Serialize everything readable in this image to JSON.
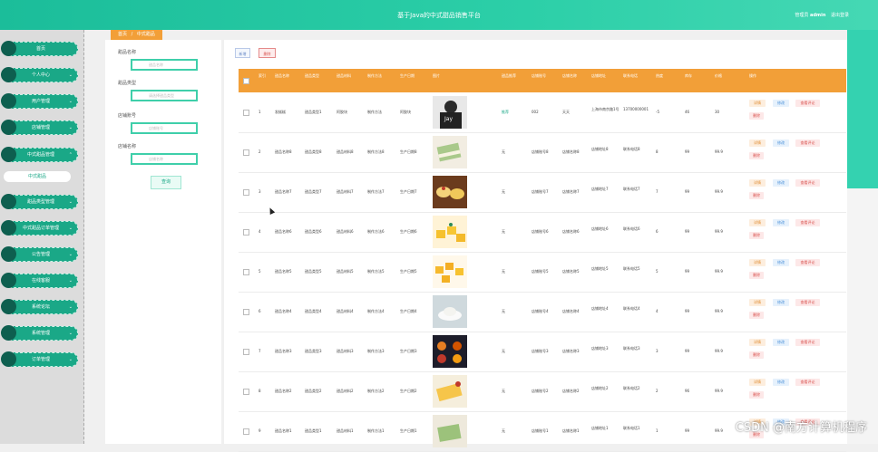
{
  "header": {
    "title": "基于Java的中式甜品销售平台",
    "user_prefix": "管理员",
    "username": "admin",
    "logout": "退出登录"
  },
  "sidebar": {
    "items": [
      {
        "label": "首页",
        "chev": ""
      },
      {
        "label": "个人中心",
        "chev": "⌄"
      },
      {
        "label": "用户管理",
        "chev": "⌄"
      },
      {
        "label": "店铺管理",
        "chev": "⌄"
      },
      {
        "label": "中式甜品管理",
        "chev": "⌃"
      },
      {
        "label": "甜品类型管理",
        "chev": "⌄"
      },
      {
        "label": "中式甜品订单管理",
        "chev": "⌄"
      },
      {
        "label": "公告管理",
        "chev": "⌄"
      },
      {
        "label": "在线客服",
        "chev": "⌄"
      },
      {
        "label": "系统论坛",
        "chev": "⌄"
      },
      {
        "label": "系统管理",
        "chev": "⌄"
      },
      {
        "label": "订单管理",
        "chev": "⌄"
      }
    ],
    "sub_active": "中式甜品"
  },
  "breadcrumb": {
    "home": "首页",
    "sep": "/",
    "current": "中式甜品"
  },
  "search": {
    "fields": [
      {
        "label": "甜品名称",
        "placeholder": "甜品名称"
      },
      {
        "label": "甜品类型",
        "placeholder": "请选择甜品类型"
      },
      {
        "label": "店铺账号",
        "placeholder": "店铺账号"
      },
      {
        "label": "店铺名称",
        "placeholder": "店铺名称"
      }
    ],
    "button": "查询"
  },
  "toolbar": {
    "add": "新增",
    "delete": "删除"
  },
  "table": {
    "headers": [
      "索引",
      "甜品名称",
      "甜品类型",
      "甜品材料",
      "制作方法",
      "生产日期",
      "图片",
      "甜品推荐",
      "店铺账号",
      "店铺名称",
      "店铺地址",
      "联系电话",
      "热度",
      "库存",
      "价格",
      "操作"
    ],
    "rows": [
      {
        "idx": "1",
        "name": "发糕糕",
        "type": "甜品类型1",
        "mat": "阿胶块",
        "method": "制作方法",
        "date": "阿胶块",
        "rec": "推荐",
        "acct": "002",
        "shop": "天天",
        "addr": "上海市南京路1号",
        "tel": "13700000001",
        "heat": "-5",
        "stock": "46",
        "price": "30"
      },
      {
        "idx": "2",
        "name": "甜品名称8",
        "type": "甜品类型8",
        "mat": "甜品材料8",
        "method": "制作方法8",
        "date": "生产日期8",
        "rec": "无",
        "acct": "店铺账号8",
        "shop": "店铺名称8",
        "addr": "店铺地址8",
        "tel": "联系电话8",
        "heat": "8",
        "stock": "99",
        "price": "99.9"
      },
      {
        "idx": "3",
        "name": "甜品名称7",
        "type": "甜品类型7",
        "mat": "甜品材料7",
        "method": "制作方法7",
        "date": "生产日期7",
        "rec": "无",
        "acct": "店铺账号7",
        "shop": "店铺名称7",
        "addr": "店铺地址7",
        "tel": "联系电话7",
        "heat": "7",
        "stock": "99",
        "price": "99.9"
      },
      {
        "idx": "4",
        "name": "甜品名称6",
        "type": "甜品类型6",
        "mat": "甜品材料6",
        "method": "制作方法6",
        "date": "生产日期6",
        "rec": "无",
        "acct": "店铺账号6",
        "shop": "店铺名称6",
        "addr": "店铺地址6",
        "tel": "联系电话6",
        "heat": "6",
        "stock": "99",
        "price": "99.9"
      },
      {
        "idx": "5",
        "name": "甜品名称5",
        "type": "甜品类型5",
        "mat": "甜品材料5",
        "method": "制作方法5",
        "date": "生产日期5",
        "rec": "无",
        "acct": "店铺账号5",
        "shop": "店铺名称5",
        "addr": "店铺地址5",
        "tel": "联系电话5",
        "heat": "5",
        "stock": "99",
        "price": "99.9"
      },
      {
        "idx": "6",
        "name": "甜品名称4",
        "type": "甜品类型4",
        "mat": "甜品材料4",
        "method": "制作方法4",
        "date": "生产日期4",
        "rec": "无",
        "acct": "店铺账号4",
        "shop": "店铺名称4",
        "addr": "店铺地址4",
        "tel": "联系电话4",
        "heat": "4",
        "stock": "99",
        "price": "99.9"
      },
      {
        "idx": "7",
        "name": "甜品名称3",
        "type": "甜品类型3",
        "mat": "甜品材料3",
        "method": "制作方法3",
        "date": "生产日期3",
        "rec": "无",
        "acct": "店铺账号3",
        "shop": "店铺名称3",
        "addr": "店铺地址3",
        "tel": "联系电话3",
        "heat": "3",
        "stock": "99",
        "price": "99.9"
      },
      {
        "idx": "8",
        "name": "甜品名称2",
        "type": "甜品类型2",
        "mat": "甜品材料2",
        "method": "制作方法2",
        "date": "生产日期2",
        "rec": "无",
        "acct": "店铺账号2",
        "shop": "店铺名称2",
        "addr": "店铺地址2",
        "tel": "联系电话2",
        "heat": "2",
        "stock": "96",
        "price": "99.9"
      },
      {
        "idx": "9",
        "name": "甜品名称1",
        "type": "甜品类型1",
        "mat": "甜品材料1",
        "method": "制作方法1",
        "date": "生产日期1",
        "rec": "无",
        "acct": "店铺账号1",
        "shop": "店铺名称1",
        "addr": "店铺地址1",
        "tel": "联系电话1",
        "heat": "1",
        "stock": "99",
        "price": "99.9"
      }
    ],
    "actions": {
      "detail": "详情",
      "edit": "修改",
      "review": "查看评论",
      "delete": "删除"
    }
  },
  "watermark": "CSDN @南方计算机程序",
  "colors": {
    "accent": "#1bbd9a",
    "header_row": "#f29f38",
    "sidebar_item": "#1aa887"
  }
}
